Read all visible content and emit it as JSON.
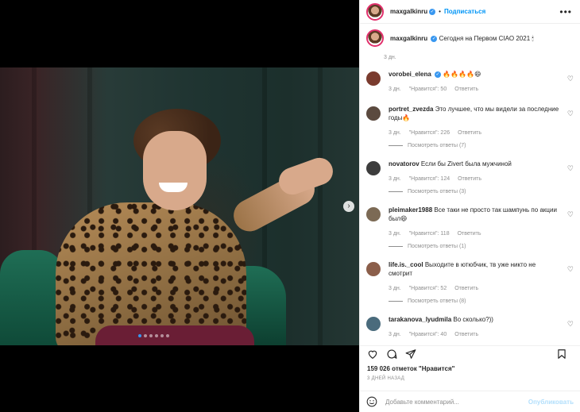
{
  "post": {
    "username": "maxgalkinru",
    "follow_label": "Подписаться",
    "dot": "•",
    "caption": "Сегодня на Первом CIAO 2021 🕯",
    "caption_time": "3 дн."
  },
  "comments": [
    {
      "user": "vorobei_elena",
      "verified": true,
      "text": "🔥🔥🔥🔥😄",
      "time": "3 дн.",
      "like_label": "\"Нравится\": 50",
      "reply_label": "Ответить",
      "avatar_color": "#7a3b2e"
    },
    {
      "user": "portret_zvezda",
      "verified": false,
      "text": "Это лучшее, что мы видели за последние годы🔥",
      "time": "3 дн.",
      "like_label": "\"Нравится\": 226",
      "reply_label": "Ответить",
      "replies": "Посмотреть ответы (7)",
      "avatar_color": "#5b4a3f"
    },
    {
      "user": "novatorov",
      "verified": false,
      "text": "Если бы Zivert была мужчиной",
      "time": "3 дн.",
      "like_label": "\"Нравится\": 124",
      "reply_label": "Ответить",
      "replies": "Посмотреть ответы (3)",
      "avatar_color": "#3d3d3d"
    },
    {
      "user": "pleimaker1988",
      "verified": false,
      "text": "Все таки не просто так шампунь по акции был😄",
      "time": "3 дн.",
      "like_label": "\"Нравится\": 118",
      "reply_label": "Ответить",
      "replies": "Посмотреть ответы (1)",
      "avatar_color": "#7c6a55"
    },
    {
      "user": "life.is._cool",
      "verified": false,
      "text": "Выходите в ютюбчик, тв уже никто не смотрит",
      "time": "3 дн.",
      "like_label": "\"Нравится\": 52",
      "reply_label": "Ответить",
      "replies": "Посмотреть ответы (8)",
      "avatar_color": "#8b5e4a"
    },
    {
      "user": "tarakanova_lyudmila",
      "verified": false,
      "text": "Во сколько?))",
      "time": "3 дн.",
      "like_label": "\"Нравится\": 40",
      "reply_label": "Ответить",
      "avatar_color": "#4a6b7c"
    }
  ],
  "actions": {
    "likes": "159 026 отметок \"Нравится\"",
    "posted": "3 ДНЕЙ НАЗАД"
  },
  "comment_box": {
    "placeholder": "Добавьте комментарий...",
    "publish": "Опубликовать"
  },
  "colors": {
    "accent": "#0095f6",
    "muted": "#8e8e8e",
    "verified": "#3897f0"
  }
}
